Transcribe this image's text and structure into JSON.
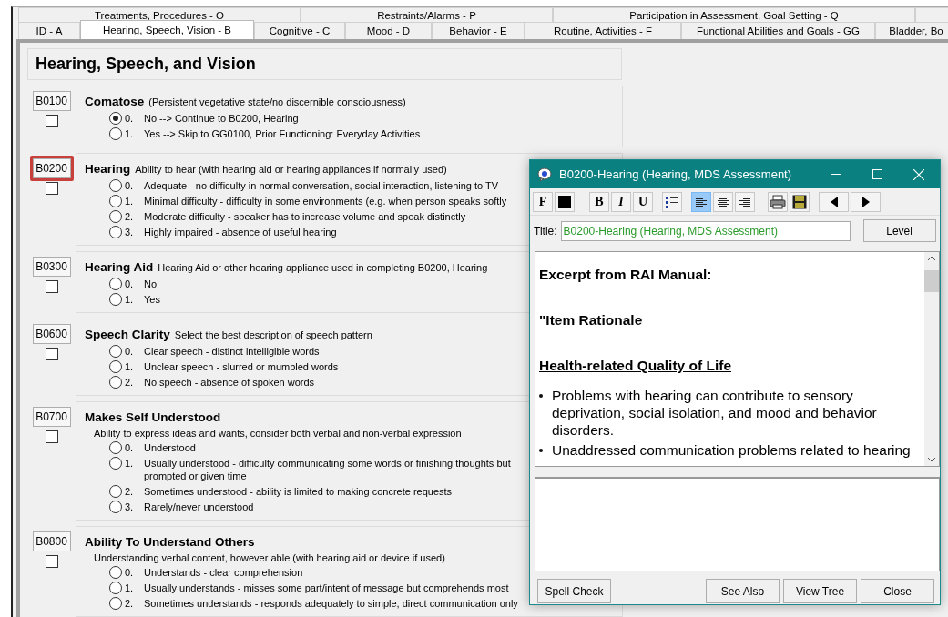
{
  "tabs_row_1": [
    {
      "label": "Treatments, Procedures - O",
      "selected": false
    },
    {
      "label": "Restraints/Alarms - P",
      "selected": false
    },
    {
      "label": "Participation in Assessment, Goal Setting - Q",
      "selected": false
    }
  ],
  "tabs_row_2": [
    {
      "label": "ID - A",
      "selected": false
    },
    {
      "label": "Hearing, Speech, Vision - B",
      "selected": true
    },
    {
      "label": "Cognitive - C",
      "selected": false
    },
    {
      "label": "Mood - D",
      "selected": false
    },
    {
      "label": "Behavior - E",
      "selected": false
    },
    {
      "label": "Routine, Activities - F",
      "selected": false
    },
    {
      "label": "Functional Abilities and Goals - GG",
      "selected": false
    },
    {
      "label": "Bladder, Bo",
      "selected": false
    }
  ],
  "section_title": "Hearing, Speech, and Vision",
  "items": [
    {
      "code": "B0100",
      "highlighted": false,
      "checked": false,
      "kind": "inline",
      "title": "Comatose",
      "description": "(Persistent vegetative state/no discernible consciousness)",
      "options": [
        {
          "number": "0.",
          "text": "No --> Continue to B0200, Hearing",
          "selected": true
        },
        {
          "number": "1.",
          "text": "Yes --> Skip to GG0100, Prior Functioning: Everyday Activities",
          "selected": false
        }
      ]
    },
    {
      "code": "B0200",
      "highlighted": true,
      "checked": false,
      "kind": "inline",
      "title": "Hearing",
      "description": "Ability to hear (with hearing aid or hearing appliances if normally used)",
      "options": [
        {
          "number": "0.",
          "text": "Adequate - no difficulty in normal conversation, social interaction, listening to TV",
          "selected": false
        },
        {
          "number": "1.",
          "text": "Minimal difficulty - difficulty in some environments (e.g. when person speaks softly",
          "selected": false
        },
        {
          "number": "2.",
          "text": "Moderate difficulty - speaker has to increase volume and speak distinctly",
          "selected": false
        },
        {
          "number": "3.",
          "text": "Highly impaired - absence of useful hearing",
          "selected": false
        }
      ]
    },
    {
      "code": "B0300",
      "highlighted": false,
      "checked": false,
      "kind": "inline",
      "title": "Hearing Aid",
      "description": "Hearing Aid or other hearing appliance used in completing B0200, Hearing",
      "options": [
        {
          "number": "0.",
          "text": "No",
          "selected": false
        },
        {
          "number": "1.",
          "text": "Yes",
          "selected": false
        }
      ]
    },
    {
      "code": "B0600",
      "highlighted": false,
      "checked": false,
      "kind": "inline",
      "title": "Speech Clarity",
      "description": "Select the best description of speech pattern",
      "options": [
        {
          "number": "0.",
          "text": "Clear speech - distinct intelligible words",
          "selected": false
        },
        {
          "number": "1.",
          "text": "Unclear speech - slurred or mumbled words",
          "selected": false
        },
        {
          "number": "2.",
          "text": "No speech - absence of spoken words",
          "selected": false
        }
      ]
    },
    {
      "code": "B0700",
      "highlighted": false,
      "checked": false,
      "kind": "stacked",
      "title": "Makes Self Understood",
      "description": "Ability to express ideas and wants, consider both verbal and non-verbal expression",
      "options": [
        {
          "number": "0.",
          "text": "Understood",
          "selected": false
        },
        {
          "number": "1.",
          "text": "Usually understood - difficulty communicating some words or finishing thoughts but",
          "text_line_2": "prompted or given time",
          "selected": false
        },
        {
          "number": "2.",
          "text": "Sometimes understood - ability is limited to making concrete requests",
          "selected": false
        },
        {
          "number": "3.",
          "text": "Rarely/never understood",
          "selected": false
        }
      ]
    },
    {
      "code": "B0800",
      "highlighted": false,
      "checked": false,
      "kind": "stacked",
      "title": "Ability To Understand Others",
      "description": "Understanding verbal content, however able (with hearing aid or device if used)",
      "options": [
        {
          "number": "0.",
          "text": "Understands - clear comprehension",
          "selected": false
        },
        {
          "number": "1.",
          "text": "Usually understands - misses some part/intent of message but comprehends most",
          "selected": false
        },
        {
          "number": "2.",
          "text": "Sometimes understands - responds adequately to simple, direct communication only",
          "selected": false
        }
      ]
    }
  ],
  "dialog": {
    "title": "B0200-Hearing (Hearing, MDS Assessment)",
    "toolbar": [
      {
        "kind": "font",
        "label": "F"
      },
      {
        "kind": "color"
      },
      {
        "kind": "bold",
        "label": "B"
      },
      {
        "kind": "italic",
        "label": "I"
      },
      {
        "kind": "underline",
        "label": "U"
      },
      {
        "kind": "bullets"
      },
      {
        "kind": "align-left",
        "selected": true
      },
      {
        "kind": "align-center",
        "selected": false
      },
      {
        "kind": "align-right",
        "selected": false
      },
      {
        "kind": "print"
      },
      {
        "kind": "save"
      },
      {
        "kind": "previous"
      },
      {
        "kind": "next"
      }
    ],
    "title_label": "Title:",
    "title_value": "B0200-Hearing (Hearing, MDS Assessment)",
    "level_button": "Level",
    "content": [
      {
        "kind": "heading",
        "text": "Excerpt from RAI Manual:"
      },
      {
        "kind": "heading",
        "text": "\"Item Rationale"
      },
      {
        "kind": "underlined-heading",
        "text": "Health-related Quality of Life"
      },
      {
        "kind": "bullet",
        "text": "Problems with hearing can contribute to sensory deprivation, social isolation, and mood and behavior disorders."
      },
      {
        "kind": "bullet",
        "text": "Unaddressed communication problems related to hearing"
      }
    ],
    "left_buttons": [
      "Spell Check"
    ],
    "right_buttons": [
      "See Also",
      "View Tree",
      "Close"
    ]
  }
}
